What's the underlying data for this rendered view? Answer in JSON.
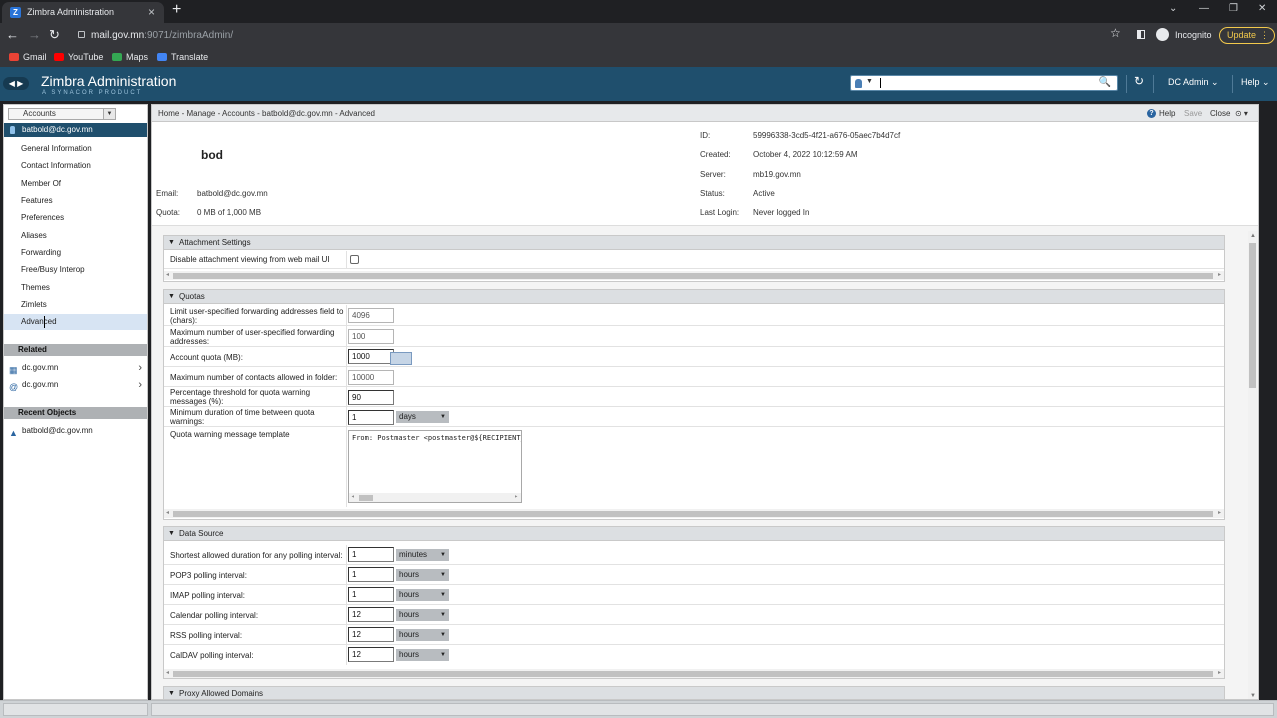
{
  "browser": {
    "tab_title": "Zimbra Administration",
    "tab_close": "×",
    "new_tab": "+",
    "url_host": "mail.gov.mn",
    "url_path": ":9071/zimbraAdmin/",
    "incognito_label": "Incognito",
    "update_label": "Update",
    "bookmarks": [
      {
        "label": "Gmail",
        "color": "#ea4335"
      },
      {
        "label": "YouTube",
        "color": "#ff0000"
      },
      {
        "label": "Maps",
        "color": "#34a853"
      },
      {
        "label": "Translate",
        "color": "#4285f4"
      }
    ]
  },
  "zimbra": {
    "app_title": "Zimbra Administration",
    "app_subtitle": "A SYNACOR PRODUCT",
    "user_menu": "DC Admin",
    "help_menu": "Help"
  },
  "sidebar": {
    "selector_label": "Accounts",
    "current_account": "batbold@dc.gov.mn",
    "items": [
      {
        "label": "General Information"
      },
      {
        "label": "Contact Information"
      },
      {
        "label": "Member Of"
      },
      {
        "label": "Features"
      },
      {
        "label": "Preferences"
      },
      {
        "label": "Aliases"
      },
      {
        "label": "Forwarding"
      },
      {
        "label": "Free/Busy Interop"
      },
      {
        "label": "Themes"
      },
      {
        "label": "Zimlets"
      },
      {
        "label": "Advanced"
      }
    ],
    "related_header": "Related",
    "related": [
      {
        "label": "dc.gov.mn"
      },
      {
        "label": "dc.gov.mn"
      }
    ],
    "recent_header": "Recent Objects",
    "recent": [
      {
        "label": "batbold@dc.gov.mn"
      }
    ]
  },
  "main": {
    "breadcrumb": "Home - Manage - Accounts - batbold@dc.gov.mn - Advanced",
    "toolbar": {
      "help": "Help",
      "save": "Save",
      "close": "Close"
    },
    "account": {
      "name": "bod",
      "email_label": "Email:",
      "email": "batbold@dc.gov.mn",
      "quota_label": "Quota:",
      "quota": "0 MB of 1,000 MB",
      "id_label": "ID:",
      "id": "59996338-3cd5-4f21-a676-05aec7b4d7cf",
      "created_label": "Created:",
      "created": "October 4, 2022 10:12:59 AM",
      "server_label": "Server:",
      "server": "mb19.gov.mn",
      "status_label": "Status:",
      "status": "Active",
      "last_login_label": "Last Login:",
      "last_login": "Never logged In"
    },
    "attachment": {
      "title": "Attachment Settings",
      "disable_label": "Disable attachment viewing from web mail UI"
    },
    "quotas": {
      "title": "Quotas",
      "fwd_field_label": "Limit user-specified forwarding addresses field to (chars):",
      "fwd_field_value": "4096",
      "max_fwd_label": "Maximum number of user-specified forwarding addresses:",
      "max_fwd_value": "100",
      "account_quota_label": "Account quota (MB):",
      "account_quota_value": "1000",
      "max_contacts_label": "Maximum number of contacts allowed in folder:",
      "max_contacts_value": "10000",
      "pct_label": "Percentage threshold for quota warning messages (%):",
      "pct_value": "90",
      "min_dur_label": "Minimum duration of time between quota warnings:",
      "min_dur_value": "1",
      "min_dur_unit": "days",
      "template_label": "Quota warning message template",
      "template_value": "From: Postmaster <postmaster@${RECIPIENT_DOMAIN}>"
    },
    "data_source": {
      "title": "Data Source",
      "rows": [
        {
          "label": "Shortest allowed duration for any polling interval:",
          "value": "1",
          "unit": "minutes"
        },
        {
          "label": "POP3 polling interval:",
          "value": "1",
          "unit": "hours"
        },
        {
          "label": "IMAP polling interval:",
          "value": "1",
          "unit": "hours"
        },
        {
          "label": "Calendar polling interval:",
          "value": "12",
          "unit": "hours"
        },
        {
          "label": "RSS polling interval:",
          "value": "12",
          "unit": "hours"
        },
        {
          "label": "CalDAV polling interval:",
          "value": "12",
          "unit": "hours"
        }
      ]
    },
    "proxy": {
      "title": "Proxy Allowed Domains"
    }
  }
}
